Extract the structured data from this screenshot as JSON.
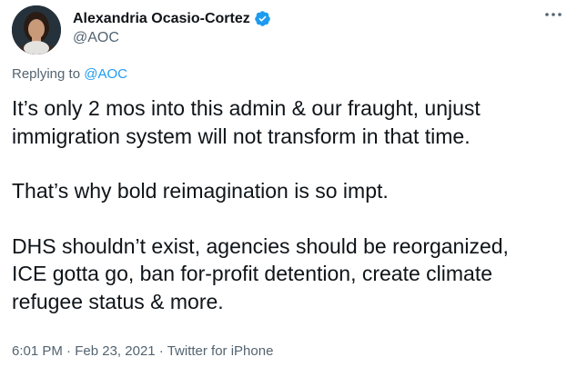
{
  "author": {
    "display_name": "Alexandria Ocasio-Cortez",
    "handle": "@AOC",
    "verified": true,
    "verified_color": "#1d9bf0"
  },
  "icons": {
    "avatar": "profile-photo",
    "verified": "verified-badge-icon",
    "more": "more-options-icon"
  },
  "reply": {
    "prefix": "Replying to ",
    "mention": "@AOC"
  },
  "tweet": {
    "paragraphs": [
      "It’s only 2 mos into this admin & our fraught, unjust\nimmigration system will not transform in that time.",
      "That’s why bold reimagination is so impt.",
      "DHS shouldn’t exist, agencies should be reorganized,\nICE gotta go, ban for-profit detention, create climate\nrefugee status & more."
    ]
  },
  "meta": {
    "time": "6:01 PM",
    "separator": " · ",
    "date": "Feb 23, 2021",
    "source": "Twitter for iPhone"
  },
  "colors": {
    "text": "#0f1419",
    "secondary": "#536471",
    "link": "#1d9bf0"
  }
}
